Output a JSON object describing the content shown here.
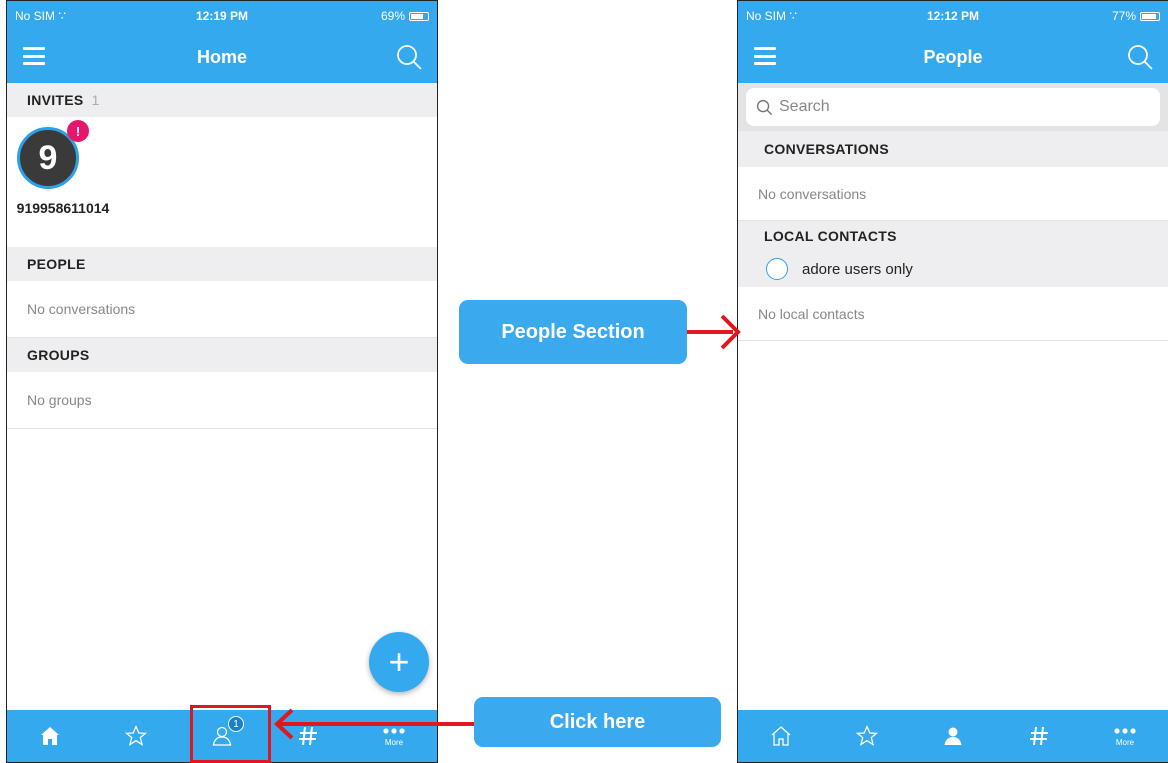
{
  "left_screen": {
    "status": {
      "carrier": "No SIM",
      "time": "12:19 PM",
      "battery": "69%"
    },
    "title": "Home",
    "invites": {
      "label": "INVITES",
      "count": "1",
      "avatar_letter": "9",
      "badge": "!",
      "name": "919958611014"
    },
    "people": {
      "label": "PEOPLE",
      "empty": "No conversations"
    },
    "groups": {
      "label": "GROUPS",
      "empty": "No groups"
    },
    "fab": "+",
    "tabs": [
      {
        "name": "home",
        "label": ""
      },
      {
        "name": "favorites",
        "label": ""
      },
      {
        "name": "people",
        "label": "",
        "badge": "1"
      },
      {
        "name": "rooms",
        "label": ""
      },
      {
        "name": "more",
        "label": "More"
      }
    ]
  },
  "right_screen": {
    "status": {
      "carrier": "No SIM",
      "time": "12:12 PM",
      "battery": "77%"
    },
    "title": "People",
    "search_placeholder": "Search",
    "conversations": {
      "label": "CONVERSATIONS",
      "empty": "No conversations"
    },
    "local_contacts": {
      "label": "LOCAL CONTACTS",
      "filter": "adore users only",
      "empty": "No local contacts"
    },
    "tabs": [
      {
        "name": "home",
        "label": ""
      },
      {
        "name": "favorites",
        "label": ""
      },
      {
        "name": "people",
        "label": ""
      },
      {
        "name": "rooms",
        "label": ""
      },
      {
        "name": "more",
        "label": "More"
      }
    ]
  },
  "callouts": {
    "people_section": "People Section",
    "click_here": "Click here"
  },
  "colors": {
    "primary": "#34a9ee",
    "badge": "#e6176a",
    "annotation": "#e0171f"
  }
}
